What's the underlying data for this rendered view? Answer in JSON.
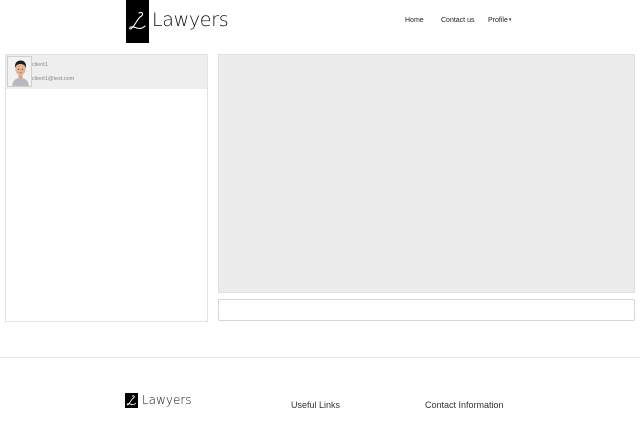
{
  "brand": {
    "name": "Lawyers",
    "logo_letter": "L"
  },
  "nav": {
    "home": "Home",
    "contact": "Contact us",
    "profile": "Profile",
    "profile_caret": "▾"
  },
  "contacts": [
    {
      "name": "client1",
      "email": "client1@test.com"
    }
  ],
  "chat": {
    "input_value": "",
    "input_placeholder": ""
  },
  "footer": {
    "brand": "Lawyers",
    "useful_links": "Useful Links",
    "contact_information": "Contact Information"
  },
  "colors": {
    "chat_background": "#ececec",
    "selected_contact": "#eeeeee",
    "logo": "#000000"
  }
}
